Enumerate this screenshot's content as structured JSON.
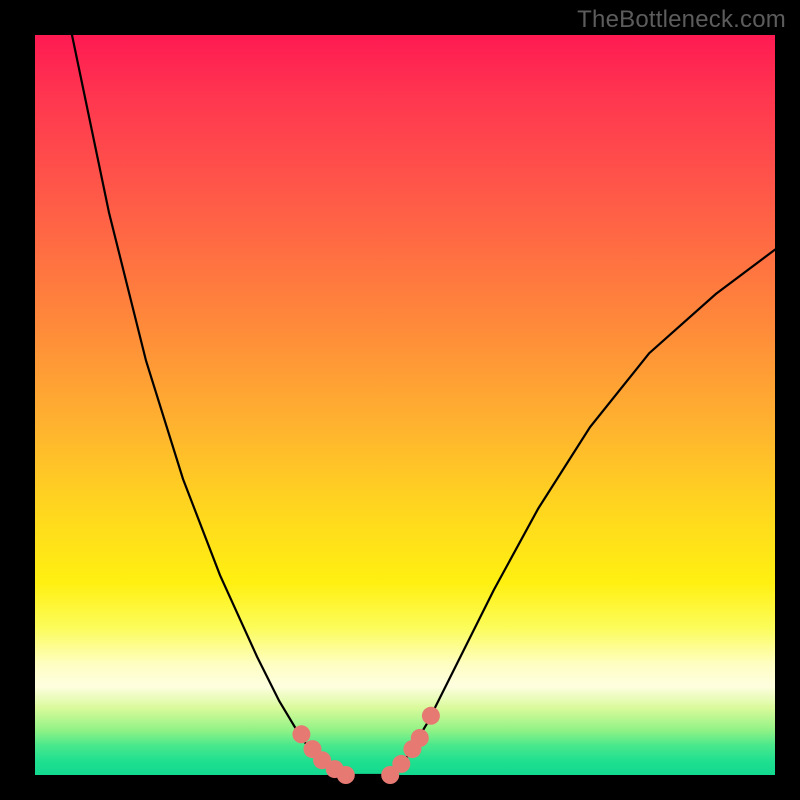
{
  "watermark": "TheBottleneck.com",
  "colors": {
    "frame": "#000000",
    "curve": "#000000",
    "marker": "#e67a73",
    "gradient_top": "#ff1a52",
    "gradient_mid": "#ffd61f",
    "gradient_bottom": "#11d98f"
  },
  "chart_data": {
    "type": "line",
    "title": "",
    "xlabel": "",
    "ylabel": "",
    "xlim": [
      0,
      100
    ],
    "ylim": [
      0,
      100
    ],
    "annotations": [
      "TheBottleneck.com"
    ],
    "series": [
      {
        "name": "left-curve",
        "x": [
          5,
          10,
          15,
          20,
          25,
          30,
          33,
          36,
          38,
          40,
          42
        ],
        "y": [
          100,
          76,
          56,
          40,
          27,
          16,
          10,
          5,
          2.5,
          0.8,
          0
        ]
      },
      {
        "name": "valley-floor",
        "x": [
          42,
          44,
          46,
          48
        ],
        "y": [
          0,
          0,
          0,
          0
        ]
      },
      {
        "name": "right-curve",
        "x": [
          48,
          50,
          53,
          57,
          62,
          68,
          75,
          83,
          92,
          100
        ],
        "y": [
          0,
          2,
          7,
          15,
          25,
          36,
          47,
          57,
          65,
          71
        ]
      }
    ],
    "markers": {
      "name": "highlight-dots",
      "points": [
        {
          "x": 36.0,
          "y": 5.5
        },
        {
          "x": 37.5,
          "y": 3.5
        },
        {
          "x": 38.8,
          "y": 2.0
        },
        {
          "x": 40.5,
          "y": 0.8
        },
        {
          "x": 42.0,
          "y": 0.0
        },
        {
          "x": 48.0,
          "y": 0.0
        },
        {
          "x": 49.5,
          "y": 1.5
        },
        {
          "x": 51.0,
          "y": 3.5
        },
        {
          "x": 52.0,
          "y": 5.0
        },
        {
          "x": 53.5,
          "y": 8.0
        }
      ]
    }
  }
}
